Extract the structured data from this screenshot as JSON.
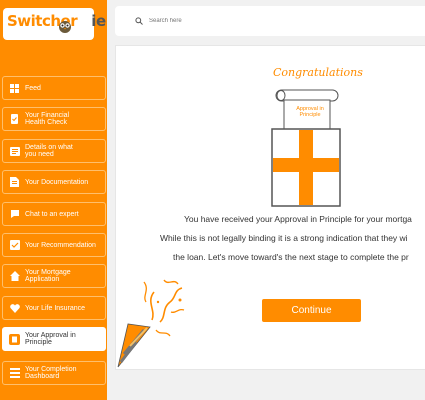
{
  "brand": {
    "name_part1": "Switcher",
    "name_part2": "ie"
  },
  "search": {
    "placeholder": "Search here"
  },
  "sidebar": {
    "items": [
      {
        "label": "Feed",
        "icon": "feed-icon"
      },
      {
        "label": "Your Financial Health Check",
        "icon": "health-check-icon"
      },
      {
        "label": "Details on what you need",
        "icon": "details-icon"
      },
      {
        "label": "Your Documentation",
        "icon": "documents-icon"
      },
      {
        "label": "Chat to an expert",
        "icon": "chat-icon"
      },
      {
        "label": "Your Recommendation",
        "icon": "recommendation-icon"
      },
      {
        "label": "Your Mortgage Application",
        "icon": "house-icon"
      },
      {
        "label": "Your Life Insurance",
        "icon": "heart-icon"
      },
      {
        "label": "Your Approval in Principle",
        "icon": "approval-icon",
        "active": true
      },
      {
        "label": "Your Completion Dashboard",
        "icon": "dashboard-icon"
      }
    ]
  },
  "main": {
    "heading": "Congratulations",
    "scroll_text": "Approval in Principle",
    "message_line1": "You have received your Approval in Principle for your mortga",
    "message_line2": "While this is not legally binding it is a strong indication that they wi",
    "message_line3": "the loan. Let's move toward's the next stage to complete the pr",
    "continue_label": "Continue"
  },
  "colors": {
    "accent": "#ff8c00",
    "sidebar_border": "#ffbf6b",
    "gift_stroke": "#555555"
  }
}
